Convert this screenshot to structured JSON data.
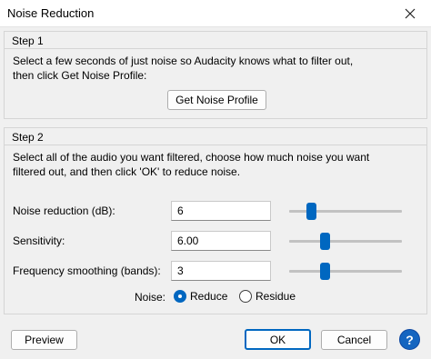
{
  "window": {
    "title": "Noise Reduction",
    "close_icon": "close-icon"
  },
  "step1": {
    "label": "Step 1",
    "line1": "Select a few seconds of just noise so Audacity knows what to filter out,",
    "line2": "then click Get Noise Profile:",
    "button_label": "Get Noise Profile"
  },
  "step2": {
    "label": "Step 2",
    "line1": "Select all of the audio you want filtered, choose how much noise you want",
    "line2": "filtered out, and then click 'OK' to reduce noise.",
    "fields": [
      {
        "label": "Noise reduction (dB):",
        "value": "6",
        "slider_fraction": 0.17
      },
      {
        "label": "Sensitivity:",
        "value": "6.00",
        "slider_fraction": 0.3
      },
      {
        "label": "Frequency smoothing (bands):",
        "value": "3",
        "slider_fraction": 0.3
      }
    ],
    "noise_label": "Noise:",
    "noise_options": [
      {
        "label": "Reduce",
        "selected": true
      },
      {
        "label": "Residue",
        "selected": false
      }
    ]
  },
  "footer": {
    "preview_label": "Preview",
    "ok_label": "OK",
    "cancel_label": "Cancel",
    "help_icon": "help-icon",
    "help_glyph": "?"
  },
  "colors": {
    "accent": "#0067c0",
    "help": "#1565c0"
  }
}
